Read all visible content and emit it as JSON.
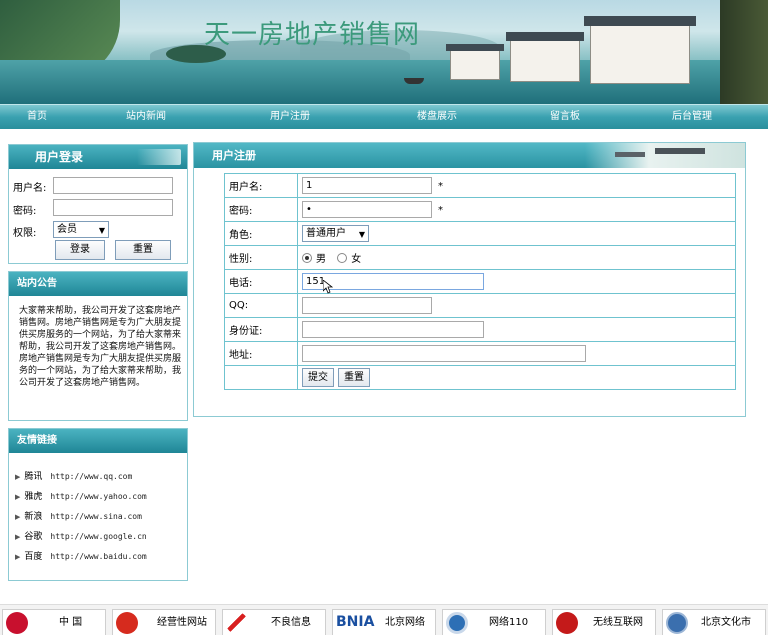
{
  "site": {
    "title": "天一房地产销售网"
  },
  "nav": {
    "items": [
      "首页",
      "站内新闻",
      "用户注册",
      "楼盘展示",
      "留言板",
      "后台管理"
    ]
  },
  "login": {
    "title": "用户登录",
    "username_label": "用户名:",
    "username_value": "",
    "password_label": "密码:",
    "password_value": "",
    "role_label": "权限:",
    "role_value": "会员",
    "login_button": "登录",
    "reset_button": "重置"
  },
  "notice": {
    "title": "站内公告",
    "text": "大家蒂来帮助，我公司开发了这套房地产销售网。房地产销售网是专为广大朋友提供买房服务的一个网站，为了给大家蒂来帮助，我公司开发了这套房地产销售网。房地产销售网是专为广大朋友提供买房服务的一个网站，为了给大家蒂来帮助，我公司开发了这套房地产销售网。"
  },
  "links": {
    "title": "友情链接",
    "items": [
      {
        "name": "腾讯",
        "url": "http://www.qq.com"
      },
      {
        "name": "雅虎",
        "url": "http://www.yahoo.com"
      },
      {
        "name": "新浪",
        "url": "http://www.sina.com"
      },
      {
        "name": "谷歌",
        "url": "http://www.google.cn"
      },
      {
        "name": "百度",
        "url": "http://www.baidu.com"
      }
    ]
  },
  "register": {
    "title": "用户注册",
    "username_label": "用户名:",
    "username_value": "1",
    "password_label": "密码:",
    "password_value": "•",
    "role_label": "角色:",
    "role_value": "普通用户",
    "gender_label": "性别:",
    "gender_options": [
      "男",
      "女"
    ],
    "gender_selected": "男",
    "phone_label": "电话:",
    "phone_value": "151",
    "qq_label": "QQ:",
    "qq_value": "",
    "idcard_label": "身份证:",
    "idcard_value": "",
    "address_label": "地址:",
    "address_value": "",
    "required_mark": "*",
    "submit_button": "提交",
    "reset_button": "重置"
  },
  "footer": {
    "badges": [
      "中 国",
      "经营性网站",
      "不良信息",
      "北京网络",
      "网络110",
      "无线互联网",
      "北京文化市"
    ],
    "badge_logo_text": "BNIA"
  },
  "colors": {
    "accent": "#2a93a2",
    "border": "#6fc3cf",
    "title_green": "#3c9a7c"
  }
}
